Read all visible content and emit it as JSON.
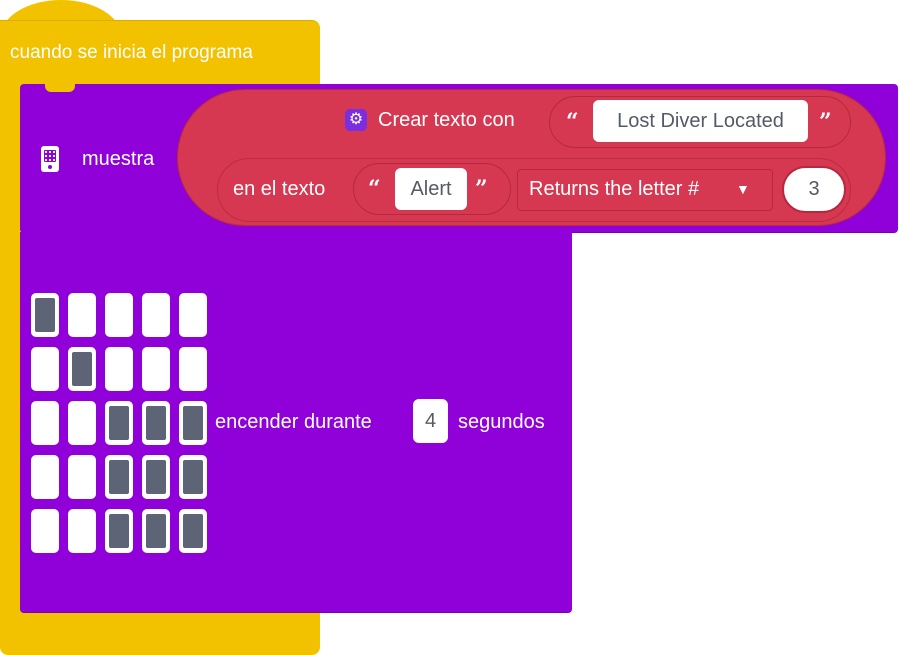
{
  "hat": {
    "label": "cuando se inicia el programa"
  },
  "show_string": {
    "label": "muestra",
    "icon": "microbit-icon"
  },
  "join_block": {
    "label": "Crear texto con",
    "icon": "gear-icon",
    "string_value": "Lost Diver Located",
    "open_quote": "“",
    "close_quote": "”"
  },
  "char_at": {
    "label": "en el texto",
    "string_value": "Alert",
    "open_quote": "“",
    "close_quote": "”",
    "dropdown_label": "Returns the letter #",
    "dropdown_arrow": "▼",
    "number": "3"
  },
  "plot_leds": {
    "label": "encender durante",
    "seconds": "4",
    "unit": "segundos",
    "grid": [
      [
        1,
        0,
        0,
        0,
        0
      ],
      [
        0,
        1,
        0,
        0,
        0
      ],
      [
        0,
        0,
        1,
        1,
        1
      ],
      [
        0,
        0,
        1,
        1,
        1
      ],
      [
        0,
        0,
        1,
        1,
        1
      ]
    ]
  },
  "colors": {
    "event_yellow": "#f2c200",
    "basic_purple": "#9000d8",
    "text_red": "#d63751",
    "led_on": "#5c6475"
  }
}
